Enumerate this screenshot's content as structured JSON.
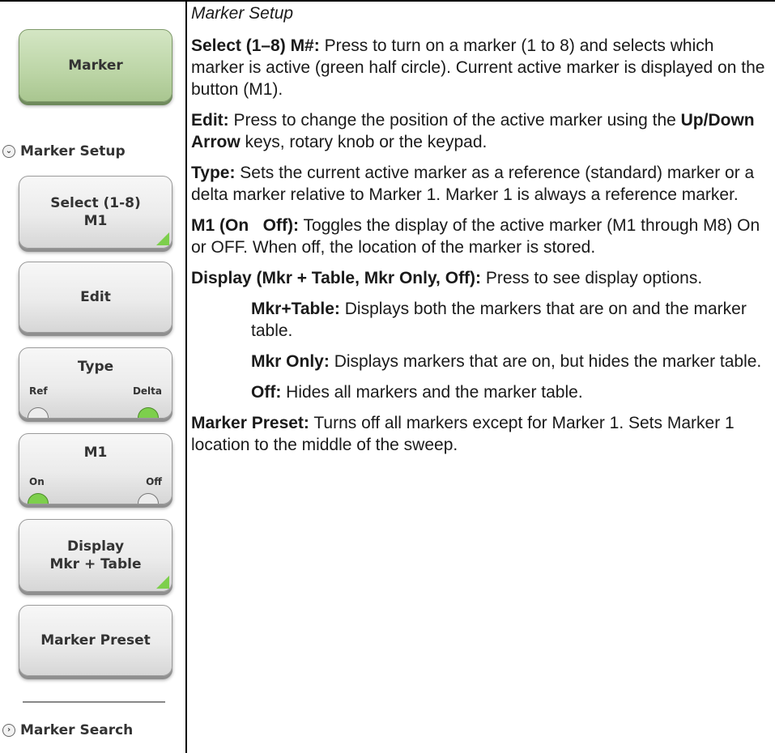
{
  "left_menu": {
    "marker_button": "Marker",
    "marker_setup_header": "Marker Setup",
    "select_button": {
      "line1": "Select (1-8)",
      "line2": "M1"
    },
    "edit_button": "Edit",
    "type_button": {
      "title": "Type",
      "left": "Ref",
      "right": "Delta"
    },
    "m1_button": {
      "title": "M1",
      "left": "On",
      "right": "Off"
    },
    "display_button": {
      "line1": "Display",
      "line2": "Mkr + Table"
    },
    "preset_button": "Marker Preset",
    "marker_search_header": "Marker Search"
  },
  "description": {
    "section_title": "Marker Setup",
    "select": {
      "term": "Select (1–8) M#:",
      "text": "  Press to turn on a marker (1 to 8) and selects which marker is active (green half circle). Current active marker is displayed on the button (M1)."
    },
    "edit": {
      "term": "Edit:",
      "text_a": "  Press to change the position of the active marker using the ",
      "keys": "Up/Down Arrow",
      "text_b": " keys, rotary knob or the keypad."
    },
    "type": {
      "term": "Type:",
      "text": "  Sets the current active marker as a reference (standard) marker or a delta marker relative to Marker 1. Marker 1 is always a reference marker."
    },
    "m1": {
      "term": "M1 (On   Off):",
      "text": "  Toggles the display of the active marker (M1 through M8) On or OFF. When off, the location of the marker is stored."
    },
    "display": {
      "term": "Display (Mkr + Table, Mkr Only, Off):",
      "text": "  Press to see display options."
    },
    "mkr_table": {
      "term": "Mkr+Table:",
      "text": "  Displays both the markers that are on and the marker table."
    },
    "mkr_only": {
      "term": "Mkr Only:",
      "text": "  Displays markers that are on, but hides the marker table."
    },
    "off": {
      "term": "Off:",
      "text": "  Hides all markers and the marker table."
    },
    "preset": {
      "term": "Marker Preset:",
      "text": "  Turns off all markers except for Marker 1. Sets Marker 1 location to the middle of the sweep."
    }
  }
}
